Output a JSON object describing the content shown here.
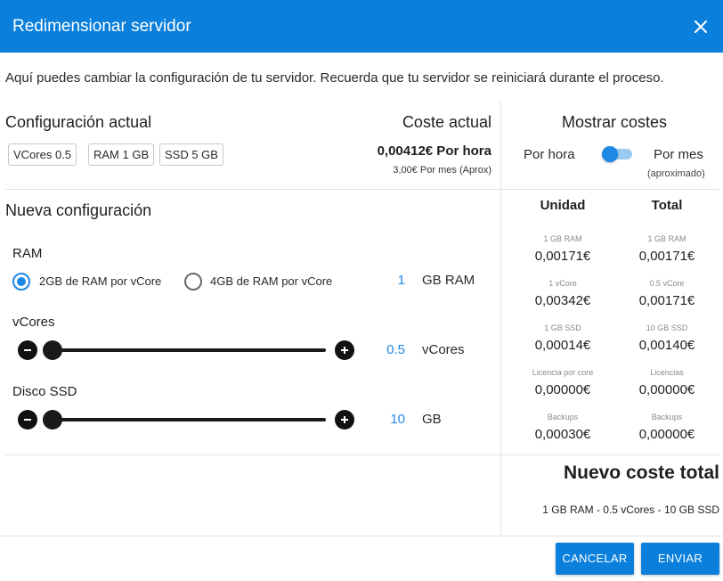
{
  "dialog": {
    "title": "Redimensionar servidor",
    "intro": "Aquí puedes cambiar la configuración de tu servidor. Recuerda que tu servidor se reiniciará durante el proceso."
  },
  "current": {
    "title": "Configuración actual",
    "chips": [
      "VCores 0.5",
      "RAM 1 GB",
      "SSD 5 GB"
    ]
  },
  "current_cost": {
    "title": "Coste actual",
    "per_hour": "0,00412€ Por hora",
    "per_month": "3,00€ Por mes (Aprox)"
  },
  "show_costs": {
    "title": "Mostrar costes",
    "option_hour": "Por hora",
    "option_month": "Por mes",
    "option_month_note": "(aproximado)",
    "selected": "Por hora"
  },
  "new_config": {
    "title": "Nueva configuración",
    "ram": {
      "label": "RAM",
      "option_a": "2GB de RAM por vCore",
      "option_b": "4GB de RAM por vCore",
      "selected": "option_a",
      "value": "1",
      "unit": "GB RAM"
    },
    "vcores": {
      "label": "vCores",
      "value": "0.5",
      "unit": "vCores",
      "slider_fraction": 0.0
    },
    "disk": {
      "label": "Disco SSD",
      "value": "10",
      "unit": "GB",
      "slider_fraction": 0.0
    }
  },
  "cost_table": {
    "col_unit": "Unidad",
    "col_total": "Total",
    "rows": [
      {
        "unit_caption": "1 GB RAM",
        "unit_value": "0,00171€",
        "total_caption": "1 GB RAM",
        "total_value": "0,00171€"
      },
      {
        "unit_caption": "1 vCore",
        "unit_value": "0,00342€",
        "total_caption": "0.5 vCore",
        "total_value": "0,00171€"
      },
      {
        "unit_caption": "1 GB SSD",
        "unit_value": "0,00014€",
        "total_caption": "10 GB SSD",
        "total_value": "0,00140€"
      },
      {
        "unit_caption": "Licencia por core",
        "unit_value": "0,00000€",
        "total_caption": "Licencias",
        "total_value": "0,00000€"
      },
      {
        "unit_caption": "Backups",
        "unit_value": "0,00030€",
        "total_caption": "Backups",
        "total_value": "0,00000€"
      }
    ]
  },
  "new_total": {
    "title": "Nuevo coste total",
    "summary": "1 GB RAM - 0.5 vCores - 10 GB SSD"
  },
  "actions": {
    "cancel": "CANCELAR",
    "submit": "ENVIAR"
  },
  "colors": {
    "primary": "#0a7fdc",
    "accent": "#1e88e5"
  },
  "icons": {
    "close": "close-icon",
    "minus": "minus-icon",
    "plus": "plus-icon"
  }
}
